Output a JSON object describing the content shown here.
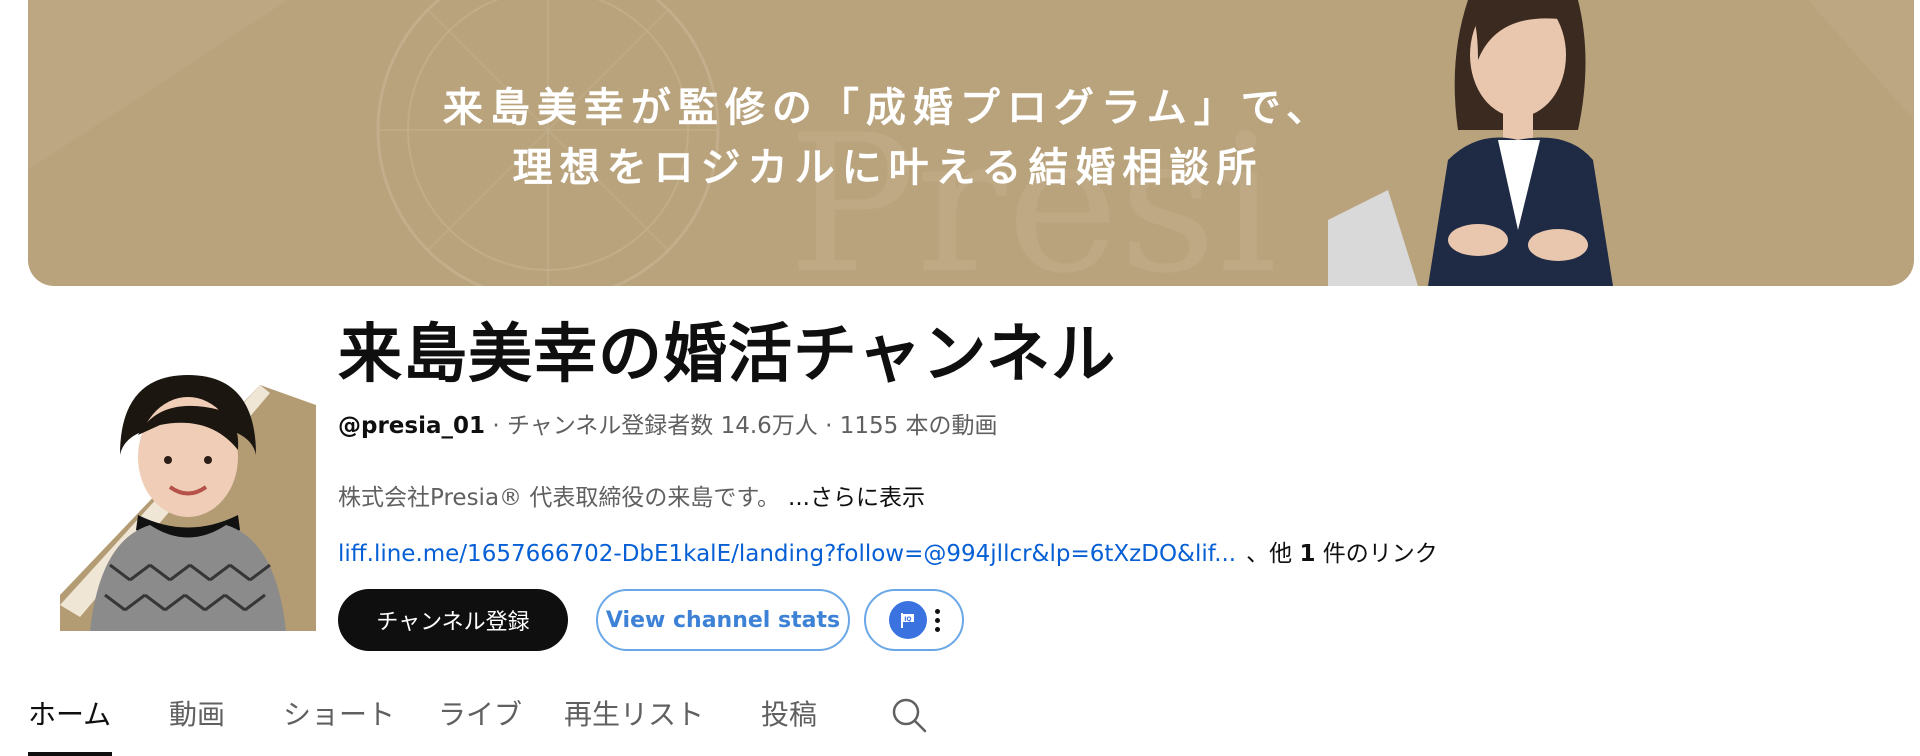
{
  "banner": {
    "line1": "来島美幸が監修の「成婚プログラム」で、",
    "line2": "理想をロジカルに叶える結婚相談所",
    "watermark": "Presi",
    "color": "#b9a37d"
  },
  "channel": {
    "title": "来島美幸の婚活チャンネル",
    "handle": "@presia_01",
    "meta_rest": " · チャンネル登録者数 14.6万人 · 1155 本の動画",
    "description": "株式会社Presia®  代表取締役の来島です。",
    "more_label": "...さらに表示",
    "link_url": "liff.line.me/1657666702-DbE1kalE/landing?follow=@994jllcr&lp=6tXzDO&lif...",
    "other_links_prefix": "、他 ",
    "other_links_count": "1",
    "other_links_suffix": " 件のリンク"
  },
  "buttons": {
    "subscribe_label": "チャンネル登録",
    "stats_label": "View channel stats",
    "extension_icon": "extension-flag-icon",
    "more_icon": "more-vert-icon"
  },
  "tabs": [
    {
      "label": "ホーム",
      "active": true
    },
    {
      "label": "動画",
      "active": false
    },
    {
      "label": "ショート",
      "active": false
    },
    {
      "label": "ライブ",
      "active": false
    },
    {
      "label": "再生リスト",
      "active": false
    },
    {
      "label": "投稿",
      "active": false
    }
  ],
  "search_icon": "search-icon",
  "colors": {
    "link": "#065fd4",
    "stats_button": "#3d82d6",
    "subscribe_bg": "#0f0f0f"
  }
}
